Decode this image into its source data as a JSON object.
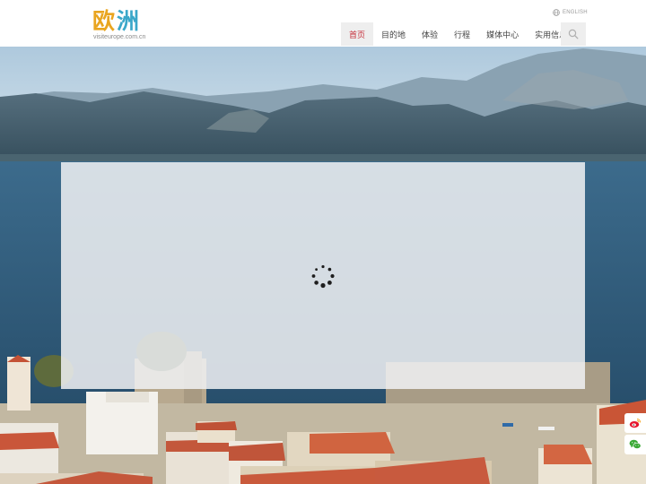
{
  "logo": {
    "chars": [
      "欧",
      "洲"
    ],
    "subtitle": "visiteurope.com.cn",
    "colors": [
      "#e9a520",
      "#3aa7c9"
    ]
  },
  "language_link": {
    "label": "ENGLISH",
    "icon": "globe-icon"
  },
  "nav": {
    "items": [
      {
        "label": "首页",
        "active": true
      },
      {
        "label": "目的地",
        "active": false
      },
      {
        "label": "体验",
        "active": false
      },
      {
        "label": "行程",
        "active": false
      },
      {
        "label": "媒体中心",
        "active": false
      },
      {
        "label": "实用信息",
        "active": false
      }
    ],
    "search_icon": "search-icon",
    "active_color": "#c62e39"
  },
  "hero": {
    "loading": true,
    "spinner_icon": "loading-spinner-icon"
  },
  "social": {
    "items": [
      {
        "name": "weibo",
        "icon": "weibo-icon",
        "color": "#e6162d"
      },
      {
        "name": "wechat",
        "icon": "wechat-icon",
        "color": "#3aa935"
      }
    ]
  }
}
